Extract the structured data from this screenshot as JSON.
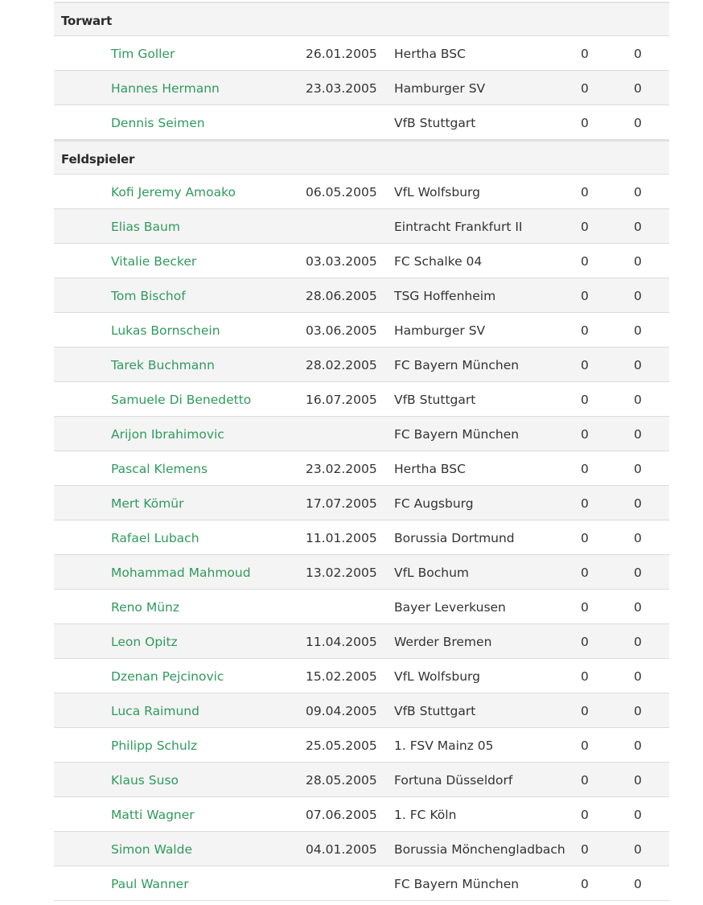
{
  "sections": [
    {
      "title": "Torwart",
      "players": [
        {
          "name": "Tim Goller",
          "birthdate": "26.01.2005",
          "club": "Hertha BSC",
          "stat1": "0",
          "stat2": "0"
        },
        {
          "name": "Hannes Hermann",
          "birthdate": "23.03.2005",
          "club": "Hamburger SV",
          "stat1": "0",
          "stat2": "0"
        },
        {
          "name": "Dennis Seimen",
          "birthdate": "",
          "club": "VfB Stuttgart",
          "stat1": "0",
          "stat2": "0"
        }
      ]
    },
    {
      "title": "Feldspieler",
      "players": [
        {
          "name": "Kofi Jeremy Amoako",
          "birthdate": "06.05.2005",
          "club": "VfL Wolfsburg",
          "stat1": "0",
          "stat2": "0"
        },
        {
          "name": "Elias Baum",
          "birthdate": "",
          "club": "Eintracht Frankfurt II",
          "stat1": "0",
          "stat2": "0"
        },
        {
          "name": "Vitalie Becker",
          "birthdate": "03.03.2005",
          "club": "FC Schalke 04",
          "stat1": "0",
          "stat2": "0"
        },
        {
          "name": "Tom Bischof",
          "birthdate": "28.06.2005",
          "club": "TSG Hoffenheim",
          "stat1": "0",
          "stat2": "0"
        },
        {
          "name": "Lukas Bornschein",
          "birthdate": "03.06.2005",
          "club": "Hamburger SV",
          "stat1": "0",
          "stat2": "0"
        },
        {
          "name": "Tarek Buchmann",
          "birthdate": "28.02.2005",
          "club": "FC Bayern München",
          "stat1": "0",
          "stat2": "0"
        },
        {
          "name": "Samuele Di Benedetto",
          "birthdate": "16.07.2005",
          "club": "VfB Stuttgart",
          "stat1": "0",
          "stat2": "0"
        },
        {
          "name": "Arijon Ibrahimovic",
          "birthdate": "",
          "club": "FC Bayern München",
          "stat1": "0",
          "stat2": "0"
        },
        {
          "name": "Pascal Klemens",
          "birthdate": "23.02.2005",
          "club": "Hertha BSC",
          "stat1": "0",
          "stat2": "0"
        },
        {
          "name": "Mert Kömür",
          "birthdate": "17.07.2005",
          "club": "FC Augsburg",
          "stat1": "0",
          "stat2": "0"
        },
        {
          "name": "Rafael Lubach",
          "birthdate": "11.01.2005",
          "club": "Borussia Dortmund",
          "stat1": "0",
          "stat2": "0"
        },
        {
          "name": "Mohammad Mahmoud",
          "birthdate": "13.02.2005",
          "club": "VfL Bochum",
          "stat1": "0",
          "stat2": "0"
        },
        {
          "name": "Reno Münz",
          "birthdate": "",
          "club": "Bayer Leverkusen",
          "stat1": "0",
          "stat2": "0"
        },
        {
          "name": "Leon Opitz",
          "birthdate": "11.04.2005",
          "club": "Werder Bremen",
          "stat1": "0",
          "stat2": "0"
        },
        {
          "name": "Dzenan Pejcinovic",
          "birthdate": "15.02.2005",
          "club": "VfL Wolfsburg",
          "stat1": "0",
          "stat2": "0"
        },
        {
          "name": "Luca Raimund",
          "birthdate": "09.04.2005",
          "club": "VfB Stuttgart",
          "stat1": "0",
          "stat2": "0"
        },
        {
          "name": "Philipp Schulz",
          "birthdate": "25.05.2005",
          "club": "1. FSV Mainz 05",
          "stat1": "0",
          "stat2": "0"
        },
        {
          "name": "Klaus Suso",
          "birthdate": "28.05.2005",
          "club": "Fortuna Düsseldorf",
          "stat1": "0",
          "stat2": "0"
        },
        {
          "name": "Matti Wagner",
          "birthdate": "07.06.2005",
          "club": "1. FC Köln",
          "stat1": "0",
          "stat2": "0"
        },
        {
          "name": "Simon Walde",
          "birthdate": "04.01.2005",
          "club": "Borussia Mönchengladbach",
          "stat1": "0",
          "stat2": "0"
        },
        {
          "name": "Paul Wanner",
          "birthdate": "",
          "club": "FC Bayern München",
          "stat1": "0",
          "stat2": "0"
        }
      ]
    }
  ],
  "colors": {
    "link": "#2f9a5e",
    "stripe": "#f4f4f4",
    "text": "#333333"
  }
}
